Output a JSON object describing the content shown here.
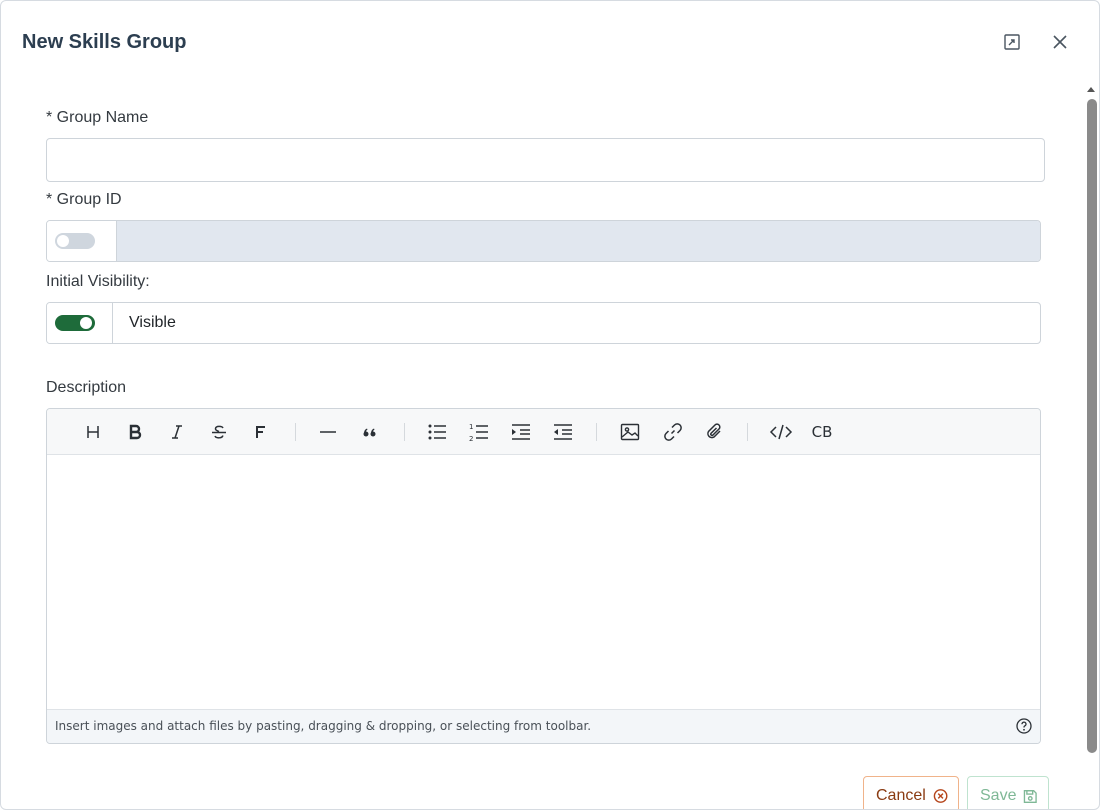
{
  "dialog": {
    "title": "New Skills Group",
    "header_buttons": [
      {
        "icon": "expand-icon"
      },
      {
        "icon": "close-icon"
      }
    ]
  },
  "form": {
    "group_name": {
      "label": "* Group Name",
      "value": "",
      "placeholder": ""
    },
    "group_id": {
      "label": "* Group ID",
      "toggle_on": false,
      "value": "",
      "disabled": true
    },
    "visibility": {
      "label": "Initial Visibility:",
      "toggle_on": true,
      "status_text": "Visible"
    },
    "description": {
      "label": "Description",
      "toolbar": [
        "heading-icon",
        "bold-icon",
        "italic-icon",
        "strikethrough-icon",
        "font-icon",
        "horizontal-rule-icon",
        "quote-icon",
        "bullet-list-icon",
        "numbered-list-icon",
        "indent-icon",
        "outdent-icon",
        "image-icon",
        "link-icon",
        "attachment-icon",
        "code-icon",
        "code-block-icon"
      ],
      "code_block_label": "CB",
      "content": "",
      "hint": "Insert images and attach files by pasting, dragging & dropping, or selecting from toolbar."
    }
  },
  "actions": {
    "cancel_label": "Cancel",
    "save_label": "Save"
  },
  "colors": {
    "toggle_on": "#1e6b3a",
    "toggle_off": "#cfd6de",
    "disabled_field": "#e1e7ef",
    "cancel_border": "#f0b38a",
    "save_border": "#bfe3cf"
  }
}
